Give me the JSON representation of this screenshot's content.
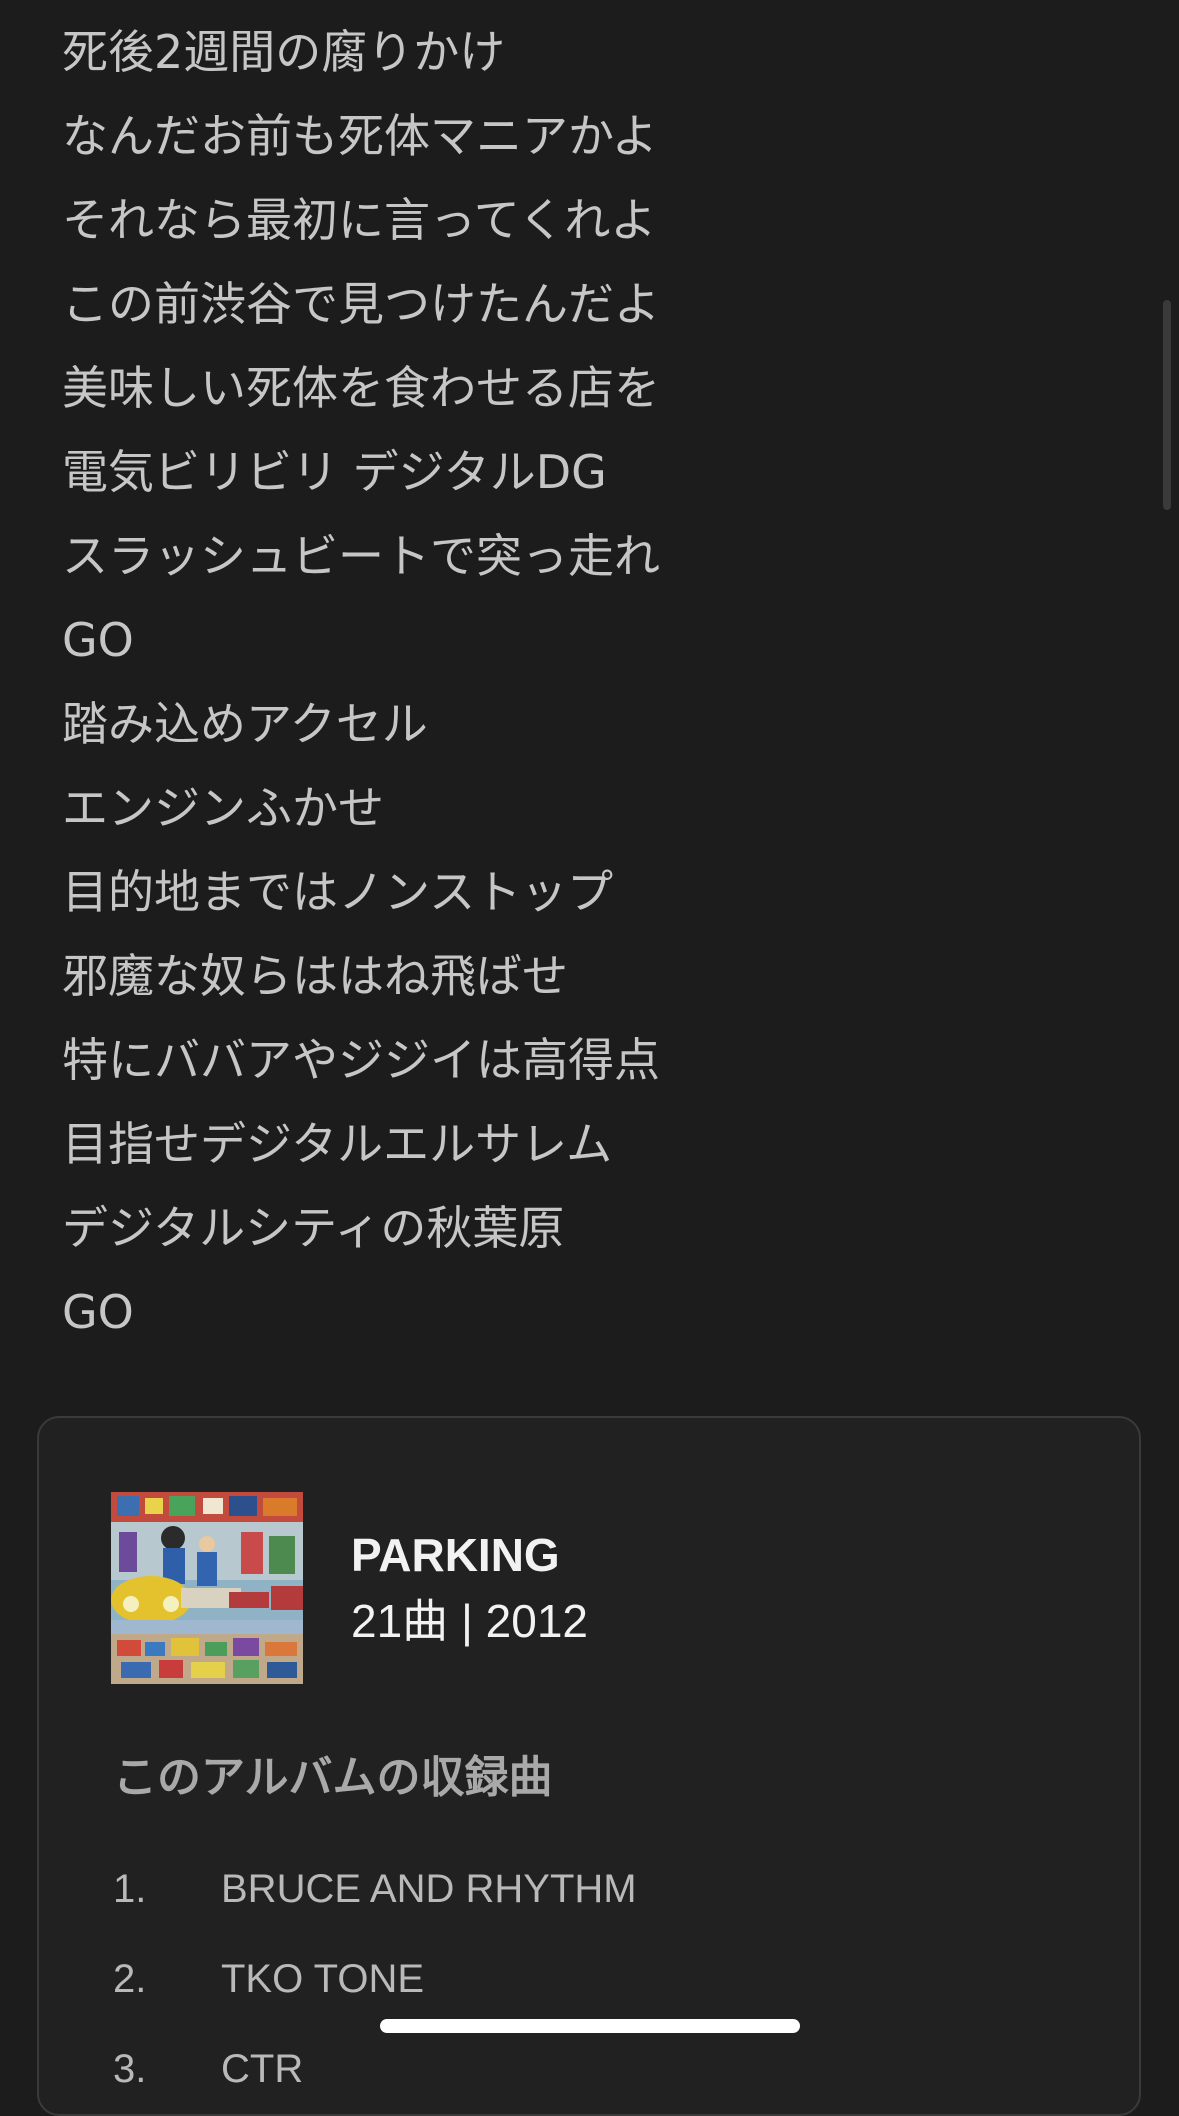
{
  "lyrics": [
    "死後2週間の腐りかけ",
    "なんだお前も死体マニアかよ",
    "それなら最初に言ってくれよ",
    "この前渋谷で見つけたんだよ",
    "美味しい死体を食わせる店を",
    "電気ビリビリ デジタルDG",
    "スラッシュビートで突っ走れ",
    "GO",
    "踏み込めアクセル",
    "エンジンふかせ",
    "目的地まではノンストップ",
    "邪魔な奴らははね飛ばせ",
    "特にババアやジジイは高得点",
    "目指せデジタルエルサレム",
    "デジタルシティの秋葉原",
    "GO"
  ],
  "album": {
    "title": "PARKING",
    "meta": "21曲 | 2012",
    "cover_icon": "album-cover-art"
  },
  "tracklist": {
    "heading": "このアルバムの収録曲",
    "tracks": [
      {
        "number": "1.",
        "title": "BRUCE AND RHYTHM"
      },
      {
        "number": "2.",
        "title": "TKO TONE"
      },
      {
        "number": "3.",
        "title": "CTR"
      }
    ]
  },
  "colors": {
    "background": "#1c1c1d",
    "card_background": "#212122",
    "card_border": "#3a3a3b",
    "lyrics_text": "#c6c6c6",
    "album_text": "#f2f2f2"
  }
}
